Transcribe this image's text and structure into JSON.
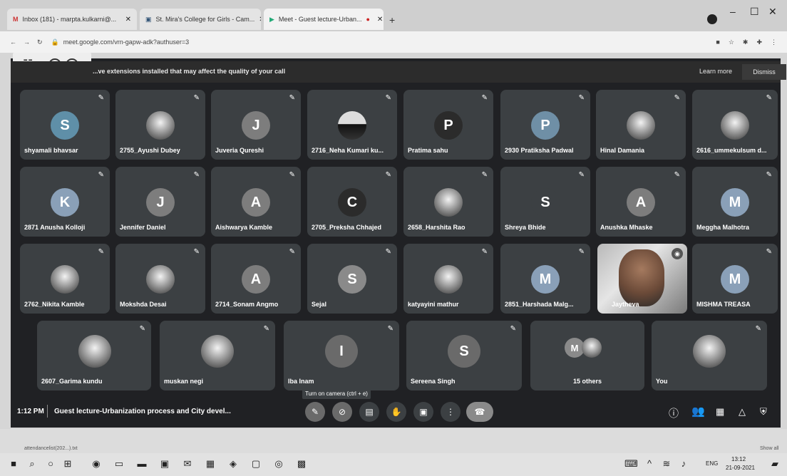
{
  "browser": {
    "tabs": [
      {
        "title": "Inbox (181) - marpta.kulkarni@...",
        "icon": "gmail-icon"
      },
      {
        "title": "St. Mira's College for Girls - Cam...",
        "icon": "doc-icon"
      },
      {
        "title": "Meet - Guest lecture-Urban...",
        "icon": "meet-icon"
      }
    ],
    "url": "meet.google.com/vrn-gapw-adk?authuser=3"
  },
  "banner": {
    "text": "...ve extensions installed that may affect the quality of your call",
    "learn_more": "Learn more",
    "dismiss": "Dismiss"
  },
  "participants": {
    "row1": [
      {
        "name": "shyamali bhavsar",
        "initial": "S",
        "color": "#5f8fa8"
      },
      {
        "name": "2755_Ayushi Dubey",
        "initial": "",
        "color": ""
      },
      {
        "name": "Juveria Qureshi",
        "initial": "J",
        "color": "#7d7d7d"
      },
      {
        "name": "2716_Neha Kumari ku...",
        "initial": "",
        "color": ""
      },
      {
        "name": "Pratima sahu",
        "initial": "P",
        "color": "#2b2b2b"
      },
      {
        "name": "2930 Pratiksha Padwal",
        "initial": "P",
        "color": "#6f8fa6"
      },
      {
        "name": "Hinal Damania",
        "initial": "",
        "color": ""
      },
      {
        "name": "2616_ummekulsum d...",
        "initial": "",
        "color": ""
      }
    ],
    "row2": [
      {
        "name": "2871 Anusha Kolloji",
        "initial": "K",
        "color": "#8aa0b8"
      },
      {
        "name": "Jennifer Daniel",
        "initial": "J",
        "color": "#7d7d7d"
      },
      {
        "name": "Aishwarya Kamble",
        "initial": "A",
        "color": "#7d7d7d"
      },
      {
        "name": "2705_Preksha Chhajed",
        "initial": "C",
        "color": "#2b2b2b"
      },
      {
        "name": "2658_Harshita Rao",
        "initial": "",
        "color": ""
      },
      {
        "name": "Shreya Bhide",
        "initial": "S",
        "color": "#3c4043"
      },
      {
        "name": "Anushka Mhaske",
        "initial": "A",
        "color": "#7d7d7d"
      },
      {
        "name": "Meggha Malhotra",
        "initial": "M",
        "color": "#8aa0b8"
      }
    ],
    "row3": [
      {
        "name": "2762_Nikita Kamble",
        "initial": "",
        "color": ""
      },
      {
        "name": "Mokshda Desai",
        "initial": "",
        "color": ""
      },
      {
        "name": "2714_Sonam Angmo",
        "initial": "A",
        "color": "#7d7d7d"
      },
      {
        "name": "Sejal",
        "initial": "S",
        "color": "#8a8a8a"
      },
      {
        "name": "katyayini mathur",
        "initial": "",
        "color": ""
      },
      {
        "name": "2851_Harshada Malg...",
        "initial": "M",
        "color": "#8aa0b8"
      },
      {
        "name": "Jaytheva",
        "initial": "",
        "color": ""
      },
      {
        "name": "MISHMA TREASA",
        "initial": "M",
        "color": "#8aa0b8"
      }
    ],
    "row4": [
      {
        "name": "2607_Garima kundu",
        "initial": "",
        "color": ""
      },
      {
        "name": "muskan negi",
        "initial": "",
        "color": ""
      },
      {
        "name": "Iba Inam",
        "initial": "I",
        "color": "#6a6a6a"
      },
      {
        "name": "Sereena Singh",
        "initial": "S",
        "color": "#6a6a6a"
      },
      {
        "name": "15 others",
        "initial": "M",
        "color": "#8a8a8a"
      },
      {
        "name": "You",
        "initial": "",
        "color": ""
      }
    ]
  },
  "tooltip": "Turn on camera (ctrl + e)",
  "bottom_bar": {
    "time": "1:12 PM",
    "meeting_title": "Guest lecture-Urbanization process and City devel..."
  },
  "taskbar": {
    "download_file": "attendancelist(202...).txt",
    "show_all": "Show all",
    "lang": "ENG",
    "clock_time": "13:12",
    "clock_date": "21-09-2021"
  }
}
